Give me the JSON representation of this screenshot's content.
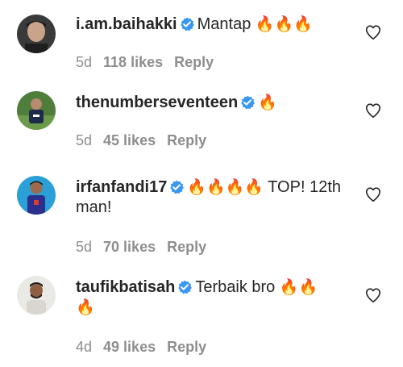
{
  "comments": [
    {
      "username": "i.am.baihakki",
      "verified": true,
      "text": "Mantap",
      "fire_line1": "🔥🔥🔥",
      "fire_line2": "",
      "extra": "",
      "age": "5d",
      "likes": "118 likes",
      "reply": "Reply",
      "avatar_icon": "profile-photo-man"
    },
    {
      "username": "thenumberseventeen",
      "verified": true,
      "text": "",
      "fire_line1": "🔥",
      "fire_line2": "",
      "extra": "",
      "age": "5d",
      "likes": "45 likes",
      "reply": "Reply",
      "avatar_icon": "profile-photo-player"
    },
    {
      "username": "irfanfandi17",
      "verified": true,
      "text": "",
      "fire_line1": "🔥🔥🔥🔥",
      "fire_line2": "",
      "extra": "TOP! 12th man!",
      "age": "5d",
      "likes": "70 likes",
      "reply": "Reply",
      "avatar_icon": "profile-photo-player-blue"
    },
    {
      "username": "taufikbatisah",
      "verified": true,
      "text": "Terbaik bro",
      "fire_line1": "🔥🔥",
      "fire_line2": "🔥",
      "extra": "",
      "age": "4d",
      "likes": "49 likes",
      "reply": "Reply",
      "avatar_icon": "profile-photo-man-beard"
    }
  ],
  "colors": {
    "verified_blue": "#3897f0",
    "meta_gray": "#8e8e8e",
    "text": "#262626"
  }
}
